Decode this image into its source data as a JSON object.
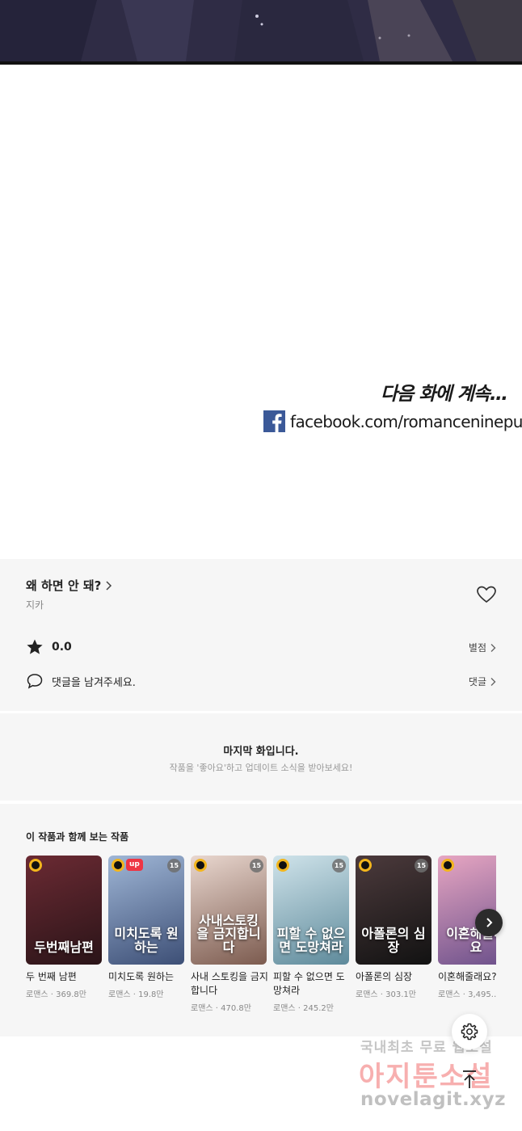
{
  "comic": {
    "continue_text": "다음 화에 계속…",
    "facebook_url": "facebook.com/romanceninepus"
  },
  "series": {
    "title": "왜 하면 안 돼?",
    "author": "지카",
    "rating": "0.0",
    "rate_link": "별점",
    "comment_prompt": "댓글을 남겨주세요.",
    "comment_link": "댓글"
  },
  "last_episode": {
    "title": "마지막 화입니다.",
    "subtitle": "작품을 '좋아요'하고 업데이트 소식을 받아보세요!"
  },
  "recommendations": {
    "heading": "이 작품과 함께 보는 작품",
    "items": [
      {
        "title": "두 번째 남편",
        "meta": "로맨스 · 369.8만",
        "cover_text": "두번째남편",
        "badges": [
          "clock"
        ],
        "colors": [
          "#6b2a33",
          "#2a1418"
        ]
      },
      {
        "title": "미치도록 원하는",
        "meta": "로맨스 · 19.8만",
        "cover_text": "미치도록 원하는",
        "badges": [
          "clock",
          "up",
          "15"
        ],
        "colors": [
          "#9fb6d6",
          "#3d4f76"
        ]
      },
      {
        "title": "사내 스토킹을 금지합니다",
        "meta": "로맨스 · 470.8만",
        "cover_text": "사내스토킹을 금지합니다",
        "badges": [
          "clock",
          "15"
        ],
        "colors": [
          "#e9d7cf",
          "#7c5b4f"
        ]
      },
      {
        "title": "피할 수 없으면 도망쳐라",
        "meta": "로맨스 · 245.2만",
        "cover_text": "피할 수 없으면 도망쳐라",
        "badges": [
          "clock",
          "15"
        ],
        "colors": [
          "#cfe3ea",
          "#5e8a9b"
        ]
      },
      {
        "title": "아폴론의 심장",
        "meta": "로맨스 · 303.1만",
        "cover_text": "아폴론의 심장",
        "badges": [
          "clock",
          "15"
        ],
        "colors": [
          "#4c3a3c",
          "#121212"
        ]
      },
      {
        "title": "이혼해줄래요?",
        "meta": "로맨스 · 3,495.…",
        "cover_text": "이혼해줄래요",
        "badges": [
          "clock"
        ],
        "colors": [
          "#e7a6c2",
          "#6a4f8a"
        ]
      }
    ]
  },
  "watermark": {
    "line1": "국내최초 무료 웹소설",
    "line2": "아지툰소설",
    "line3": "novelagit.xyz"
  },
  "colors": {
    "fb_blue": "#3b5998",
    "panel_bg": "#f6f6f6",
    "up_red": "#ee3544",
    "clock_yellow": "#f2b51c"
  }
}
